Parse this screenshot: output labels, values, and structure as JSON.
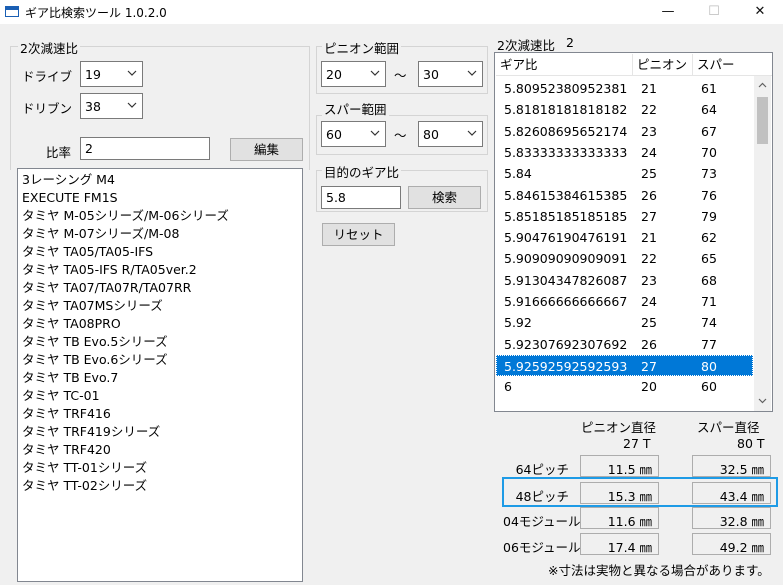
{
  "window": {
    "title": "ギア比検索ツール 1.0.2.0",
    "minimize_glyph": "—",
    "maximize_glyph": "☐",
    "close_glyph": "✕"
  },
  "left_group": {
    "label": "2次減速比",
    "drive_label": "ドライブ",
    "drive_value": "19",
    "driven_label": "ドリブン",
    "driven_value": "38",
    "ratio_label": "比率",
    "ratio_value": "2",
    "edit_button": "編集"
  },
  "cars": [
    "3レーシング M4",
    "EXECUTE FM1S",
    "タミヤ M-05シリーズ/M-06シリーズ",
    "タミヤ M-07シリーズ/M-08",
    "タミヤ TA05/TA05-IFS",
    "タミヤ TA05-IFS R/TA05ver.2",
    "タミヤ TA07/TA07R/TA07RR",
    "タミヤ TA07MSシリーズ",
    "タミヤ TA08PRO",
    "タミヤ TB Evo.5シリーズ",
    "タミヤ TB Evo.6シリーズ",
    "タミヤ TB Evo.7",
    "タミヤ TC-01",
    "タミヤ TRF416",
    "タミヤ TRF419シリーズ",
    "タミヤ TRF420",
    "タミヤ TT-01シリーズ",
    "タミヤ TT-02シリーズ"
  ],
  "pinion_range": {
    "label": "ピニオン範囲",
    "min": "20",
    "max": "30",
    "tilde": "〜"
  },
  "spur_range": {
    "label": "スパー範囲",
    "min": "60",
    "max": "80",
    "tilde": "〜"
  },
  "target": {
    "label": "目的のギア比",
    "value": "5.8",
    "search_button": "検索"
  },
  "reset_button": "リセット",
  "right_header": {
    "label": "2次減速比",
    "value": "2"
  },
  "gear_table": {
    "columns": [
      "ギア比",
      "ピニオン",
      "スパー"
    ],
    "rows": [
      [
        "5.80952380952381",
        "21",
        "61"
      ],
      [
        "5.81818181818182",
        "22",
        "64"
      ],
      [
        "5.82608695652174",
        "23",
        "67"
      ],
      [
        "5.83333333333333",
        "24",
        "70"
      ],
      [
        "5.84",
        "25",
        "73"
      ],
      [
        "5.84615384615385",
        "26",
        "76"
      ],
      [
        "5.85185185185185",
        "27",
        "79"
      ],
      [
        "5.90476190476191",
        "21",
        "62"
      ],
      [
        "5.90909090909091",
        "22",
        "65"
      ],
      [
        "5.91304347826087",
        "23",
        "68"
      ],
      [
        "5.91666666666667",
        "24",
        "71"
      ],
      [
        "5.92",
        "25",
        "74"
      ],
      [
        "5.92307692307692",
        "26",
        "77"
      ],
      [
        "5.92592592592593",
        "27",
        "80"
      ],
      [
        "6",
        "20",
        "60"
      ]
    ],
    "selected_index": 13
  },
  "diameters": {
    "pinion_header": "ピニオン直径",
    "spur_header": "スパー直径",
    "pinion_teeth": "27 T",
    "spur_teeth": "80 T",
    "rows": [
      {
        "label": "64ピッチ",
        "pinion": "11.5 ㎜",
        "spur": "32.5 ㎜"
      },
      {
        "label": "48ピッチ",
        "pinion": "15.3 ㎜",
        "spur": "43.4 ㎜"
      },
      {
        "label": "04モジュール",
        "pinion": "11.6 ㎜",
        "spur": "32.8 ㎜"
      },
      {
        "label": "06モジュール",
        "pinion": "17.4 ㎜",
        "spur": "49.2 ㎜"
      }
    ],
    "highlight_color": "#1e9be6"
  },
  "note": "※寸法は実物と異なる場合があります。"
}
